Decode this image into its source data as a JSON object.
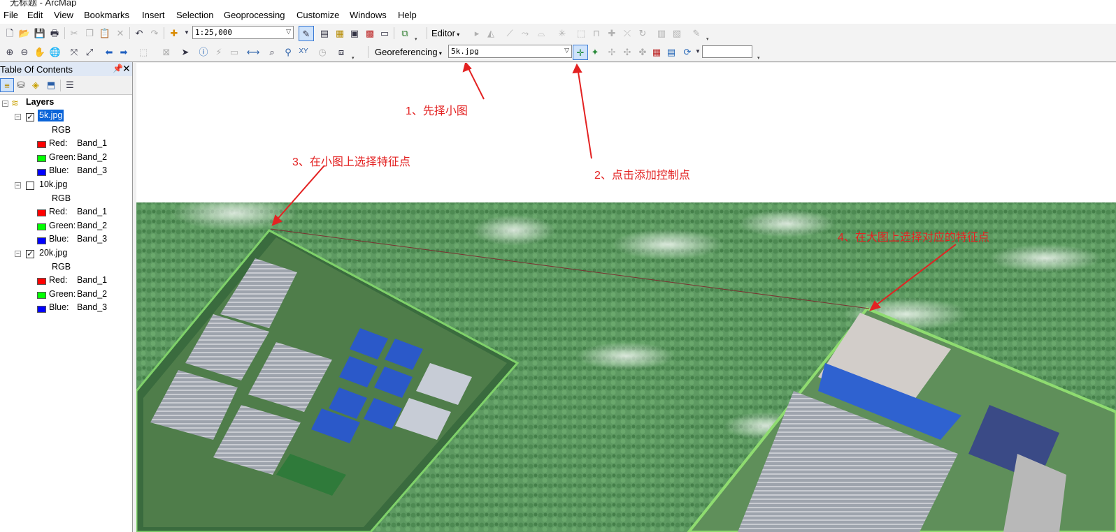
{
  "window": {
    "title": "无标题 - ArcMap"
  },
  "menu": [
    "File",
    "Edit",
    "View",
    "Bookmarks",
    "Insert",
    "Selection",
    "Geoprocessing",
    "Customize",
    "Windows",
    "Help"
  ],
  "toolbar1": {
    "scale": "1:25,000",
    "editor_label": "Editor"
  },
  "toolbar2": {
    "georef_label": "Georeferencing",
    "layer_select": "5k.jpg",
    "rotate_value": ""
  },
  "toc": {
    "title": "Table Of Contents",
    "root": "Layers",
    "layers": [
      {
        "name": "5k.jpg",
        "checked": true,
        "selected": true,
        "rgb": "RGB",
        "bands": [
          {
            "label": "Red:",
            "band": "Band_1",
            "color": "#ff0000"
          },
          {
            "label": "Green:",
            "band": "Band_2",
            "color": "#00ff00"
          },
          {
            "label": "Blue:",
            "band": "Band_3",
            "color": "#0000ff"
          }
        ]
      },
      {
        "name": "10k.jpg",
        "checked": false,
        "selected": false,
        "rgb": "RGB",
        "bands": [
          {
            "label": "Red:",
            "band": "Band_1",
            "color": "#ff0000"
          },
          {
            "label": "Green:",
            "band": "Band_2",
            "color": "#00ff00"
          },
          {
            "label": "Blue:",
            "band": "Band_3",
            "color": "#0000ff"
          }
        ]
      },
      {
        "name": "20k.jpg",
        "checked": true,
        "selected": false,
        "rgb": "RGB",
        "bands": [
          {
            "label": "Red:",
            "band": "Band_1",
            "color": "#ff0000"
          },
          {
            "label": "Green:",
            "band": "Band_2",
            "color": "#00ff00"
          },
          {
            "label": "Blue:",
            "band": "Band_3",
            "color": "#0000ff"
          }
        ]
      }
    ]
  },
  "annotations": {
    "step1": "1、先择小图",
    "step2": "2、点击添加控制点",
    "step3": "3、在小图上选择特征点",
    "step4": "4、在大图上选择对应的特征点"
  },
  "colors": {
    "annotation": "#e32222",
    "selection": "#0a64d8",
    "toc_header": "#dfe8f5"
  }
}
